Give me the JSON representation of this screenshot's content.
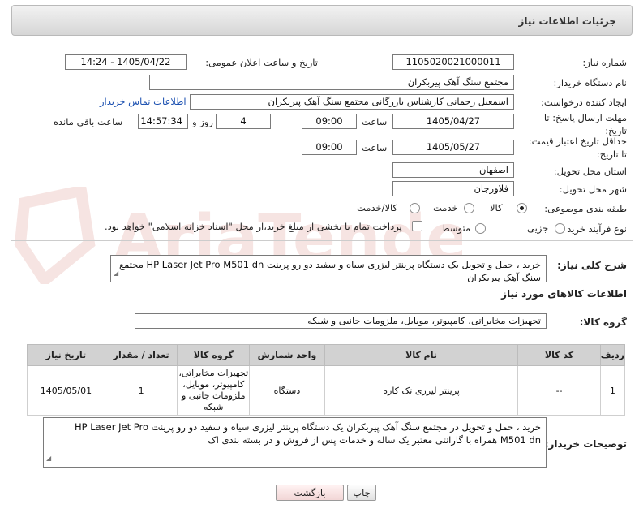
{
  "header": {
    "title": "جزئیات اطلاعات نیاز"
  },
  "form": {
    "need_number": {
      "label": "شماره نیاز:",
      "value": "1105020021000011"
    },
    "announce_datetime": {
      "label": "تاریخ و ساعت اعلان عمومی:",
      "value": "1405/04/22 - 14:24"
    },
    "buyer_org": {
      "label": "نام دستگاه خریدار:",
      "value": "مجتمع سنگ آهک پیربکران"
    },
    "requester": {
      "label": "ایجاد کننده درخواست:",
      "value": "اسمعیل رحمانی کارشناس بازرگانی مجتمع سنگ آهک پیربکران",
      "contact_link": "اطلاعات تماس خریدار"
    },
    "reply_deadline": {
      "label": "مهلت ارسال پاسخ: تا تاریخ:",
      "date": "1405/04/27",
      "time_label": "ساعت",
      "time": "09:00",
      "days": "4",
      "days_label": "روز و",
      "remaining": "14:57:34",
      "remaining_label": "ساعت باقی مانده"
    },
    "price_validity": {
      "label": "حداقل تاریخ اعتبار قیمت: تا تاریخ:",
      "date": "1405/05/27",
      "time_label": "ساعت",
      "time": "09:00"
    },
    "province": {
      "label": "استان محل تحویل:",
      "value": "اصفهان"
    },
    "city": {
      "label": "شهر محل تحویل:",
      "value": "فلاورجان"
    },
    "category": {
      "label": "طبقه بندی موضوعی:",
      "options": [
        {
          "label": "کالا",
          "checked": true
        },
        {
          "label": "خدمت",
          "checked": false
        },
        {
          "label": "کالا/خدمت",
          "checked": false
        }
      ]
    },
    "purchase_type": {
      "label": "نوع فرآیند خرید :",
      "options": [
        {
          "label": "جزیی",
          "checked": false
        },
        {
          "label": "متوسط",
          "checked": false
        }
      ],
      "payment_note": "پرداخت تمام یا بخشی از مبلغ خرید،از محل \"اسناد خزانه اسلامی\" خواهد بود."
    }
  },
  "description": {
    "label": "شرح کلی نیاز:",
    "line1": "خرید ، حمل و تحویل یک دستگاه پرینتر لیزری سیاه و سفید دو رو پرینت HP Laser Jet Pro M501 dn  مجتمع",
    "line2": "سنگ آهک پیربکران"
  },
  "goods_section": {
    "title": "اطلاعات کالاهای مورد نیاز",
    "group_label": "گروه کالا:",
    "group_value": "تجهیزات مخابراتی، کامپیوتر، موبایل، ملزومات جانبی و شبکه"
  },
  "table": {
    "headers": [
      "ردیف",
      "کد کالا",
      "نام کالا",
      "واحد شمارش",
      "گروه کالا",
      "تعداد / مقدار",
      "تاریخ نیاز"
    ],
    "row": {
      "index": "1",
      "code": "--",
      "name": "پرینتر لیزری تک کاره",
      "unit": "دستگاه",
      "group_lines": [
        "تجهیزات مخابراتی،",
        "کامپیوتر، موبایل،",
        "ملزومات جانبی و",
        "شبکه"
      ],
      "qty": "1",
      "date": "1405/05/01"
    }
  },
  "buyer_notes": {
    "label": "توضیحات خریدار:",
    "line1": "خرید ، حمل و تحویل در مجتمع سنگ آهک پیربکران یک دستگاه پرینتر لیزری سیاه و سفید دو رو پرینت HP Laser Jet Pro",
    "line2": "M501 dn  همراه با گارانتی  معتبر یک ساله و خدمات پس از فروش و در بسته بندی اک"
  },
  "buttons": {
    "print": "چاپ",
    "back": "بازگشت"
  },
  "watermark": {
    "text": "AriaTender.net"
  },
  "colors": {
    "link": "#1a4fb0",
    "header_bg": "#d6d6d6",
    "table_header": "#d2d2d2",
    "back_button": "#f2d6d6"
  }
}
